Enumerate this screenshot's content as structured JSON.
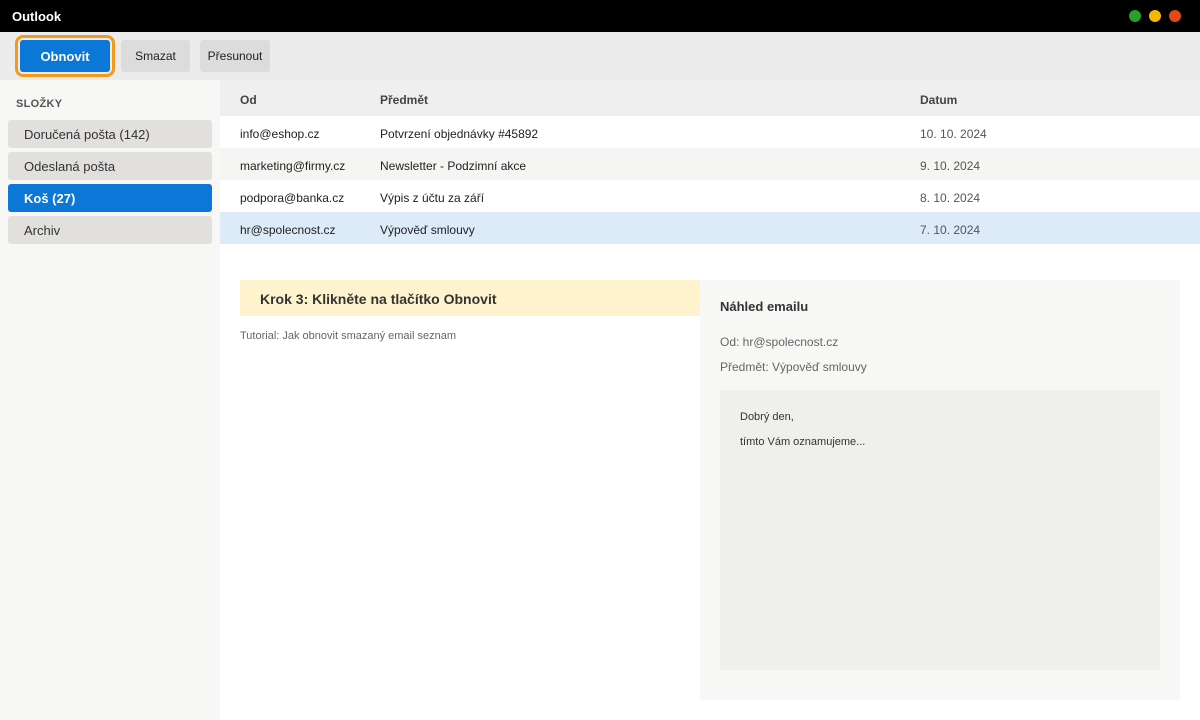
{
  "app": {
    "title": "Outlook"
  },
  "window_controls": {
    "colors": {
      "green": "#28a02a",
      "yellow": "#f5b700",
      "red": "#e34817"
    }
  },
  "toolbar": {
    "restore_label": "Obnovit",
    "delete_label": "Smazat",
    "move_label": "Přesunout"
  },
  "sidebar": {
    "title": "SLOŽKY",
    "folders": [
      {
        "label": "Doručená pošta (142)"
      },
      {
        "label": "Odeslaná pošta"
      },
      {
        "label": "Koš (27)",
        "active": true
      },
      {
        "label": "Archiv"
      }
    ]
  },
  "email_list": {
    "headers": {
      "from": "Od",
      "subject": "Předmět",
      "date": "Datum"
    },
    "rows": [
      {
        "from": "info@eshop.cz",
        "subject": "Potvrzení objednávky #45892",
        "date": "10. 10. 2024"
      },
      {
        "from": "marketing@firmy.cz",
        "subject": "Newsletter - Podzimní akce",
        "date": "9. 10. 2024"
      },
      {
        "from": "podpora@banka.cz",
        "subject": "Výpis z účtu za září",
        "date": "8. 10. 2024"
      },
      {
        "from": "hr@spolecnost.cz",
        "subject": "Výpověď smlouvy",
        "date": "7. 10. 2024",
        "selected": true
      }
    ]
  },
  "tutorial": {
    "step": "Krok 3: Klikněte na tlačítko Obnovit",
    "caption": "Tutorial: Jak obnovit smazaný email seznam"
  },
  "preview": {
    "title": "Náhled emailu",
    "from": "Od: hr@spolecnost.cz",
    "subject": "Předmět: Výpověď smlouvy",
    "body_line1": "Dobrý den,",
    "body_line2": "tímto Vám oznamujeme..."
  }
}
